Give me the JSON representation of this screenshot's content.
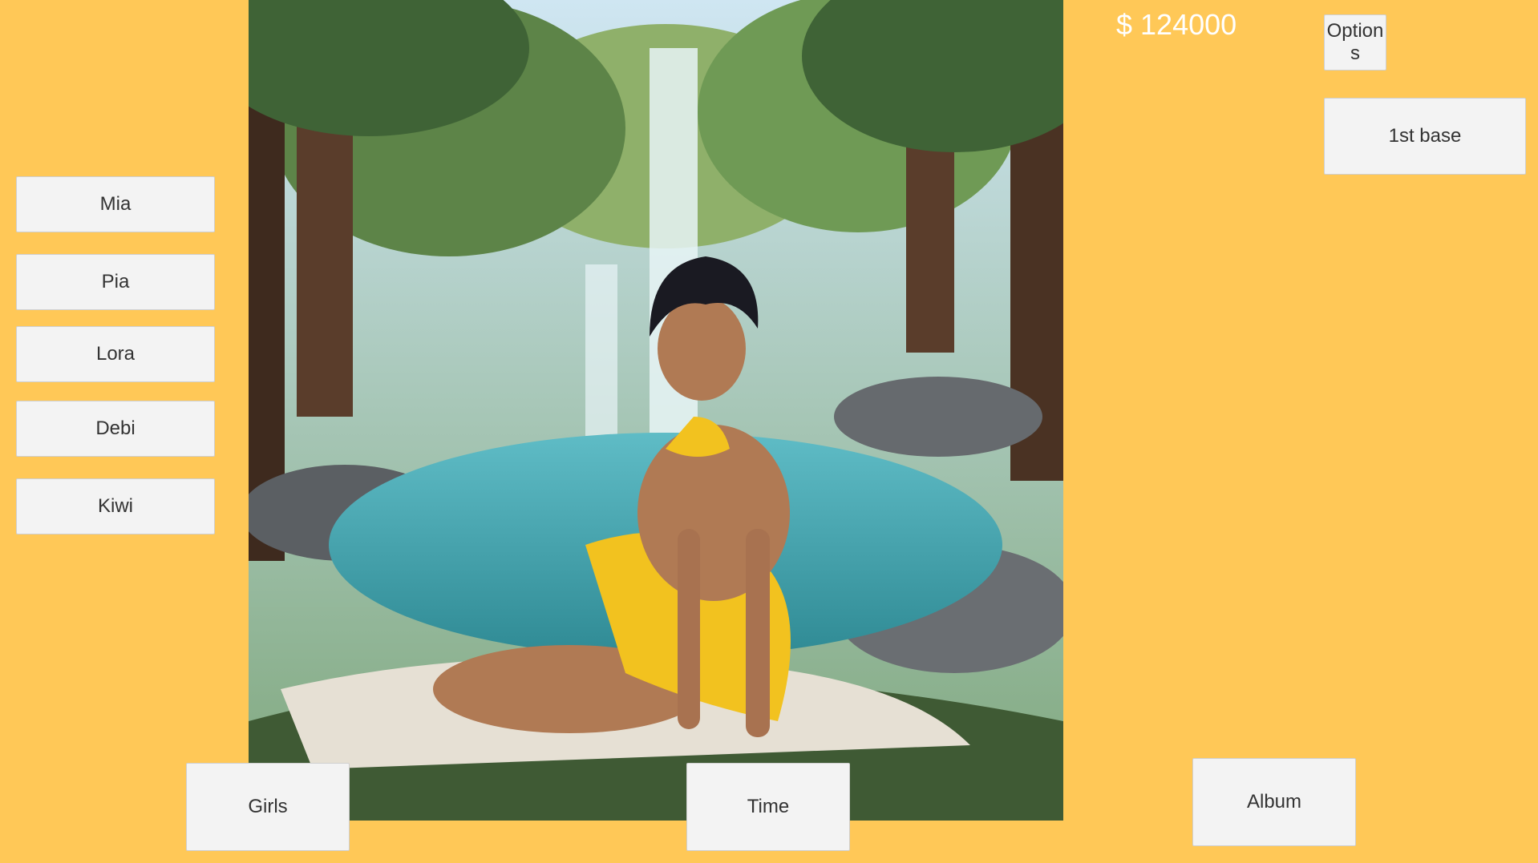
{
  "money": "$ 124000",
  "options_label": "Option\ns",
  "action_label": "1st base",
  "girls": [
    "Mia",
    "Pia",
    "Lora",
    "Debi",
    "Kiwi"
  ],
  "bottom": {
    "girls_label": "Girls",
    "time_label": "Time",
    "album_label": "Album"
  },
  "colors": {
    "background": "#FFC857",
    "button": "#F3F3F3",
    "money_text": "#FFFFFF"
  }
}
